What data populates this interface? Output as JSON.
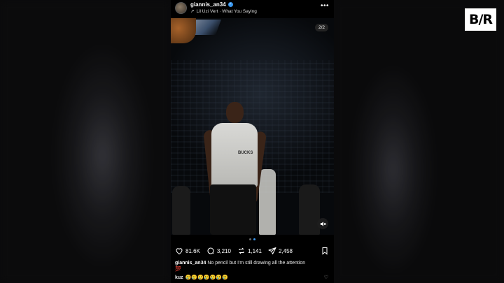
{
  "post": {
    "username": "giannis_an34",
    "music": "Lil Uzi Vert · What You Saying",
    "more_label": "•••",
    "slide_counter": "2/2",
    "shirt_text": "BUCKS"
  },
  "actions": {
    "likes": "81.6K",
    "comments": "3,210",
    "reposts": "1,141",
    "shares": "2,458"
  },
  "caption": {
    "username": "giannis_an34",
    "text": "No pencil but I'm still drawing all the attention",
    "emoji": "💯"
  },
  "comment": {
    "username": "kuz",
    "text": "🥲🥲🥲🥲🥲🥲🥲"
  },
  "brand": {
    "logo_text": "B/R"
  },
  "icons": {
    "verified": "verified-badge-icon",
    "music": "music-arrow-icon",
    "like": "heart-icon",
    "comment": "comment-bubble-icon",
    "repost": "repost-icon",
    "share": "paper-plane-icon",
    "save": "bookmark-icon",
    "mute": "mute-icon"
  },
  "colors": {
    "accent": "#3897f0",
    "background": "#000000"
  }
}
